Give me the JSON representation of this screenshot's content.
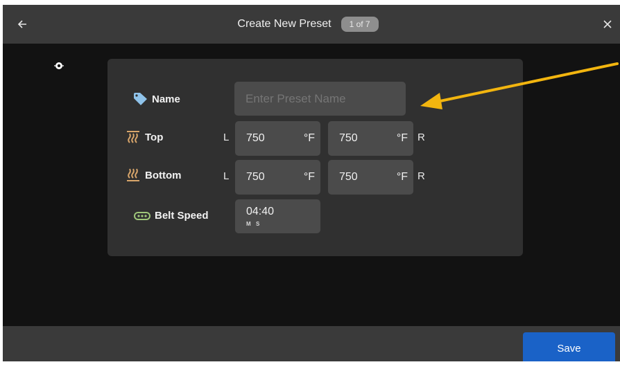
{
  "header": {
    "title": "Create New Preset",
    "step_badge": "1 of 7",
    "back_icon": "arrow-left-icon",
    "close_icon": "close-icon"
  },
  "form": {
    "name": {
      "label": "Name",
      "placeholder": "Enter Preset Name",
      "icon": "tag-icon"
    },
    "top": {
      "label": "Top",
      "icon": "heat-top-icon",
      "left_letter": "L",
      "right_letter": "R",
      "left_value": "750",
      "right_value": "750",
      "unit": "°F"
    },
    "bottom": {
      "label": "Bottom",
      "icon": "heat-bottom-icon",
      "left_letter": "L",
      "right_letter": "R",
      "left_value": "750",
      "right_value": "750",
      "unit": "°F"
    },
    "belt": {
      "label": "Belt Speed",
      "icon": "conveyor-belt-icon",
      "value": "04:40",
      "min_label": "M",
      "sec_label": "S"
    }
  },
  "footer": {
    "save_label": "Save"
  },
  "colors": {
    "heat_icon": "#d9a66b",
    "tag_icon": "#8fc3ea",
    "belt_icon": "#9fc77a",
    "save_button": "#1a62c7",
    "annotation_arrow": "#f2b50f"
  }
}
